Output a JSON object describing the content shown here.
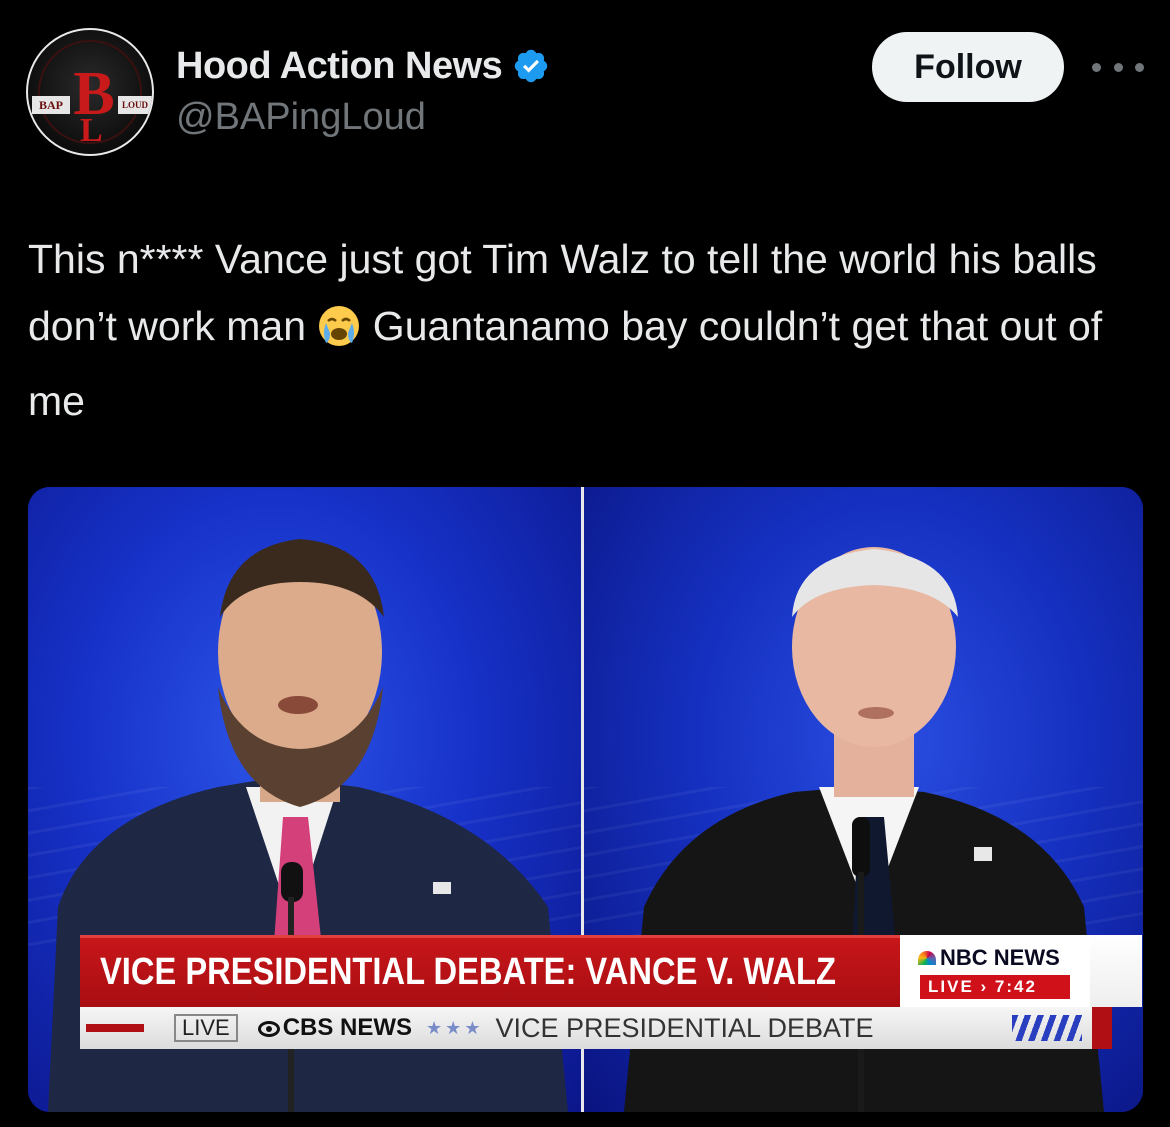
{
  "header": {
    "display_name": "Hood Action News",
    "handle": "@BAPingLoud",
    "follow_label": "Follow",
    "avatar": {
      "left_text": "BAP",
      "monogram_top": "B",
      "monogram_bottom": "L",
      "right_text": "LOUD"
    },
    "verified_icon": "verified-badge-icon",
    "more_icon": "more-options-icon"
  },
  "post": {
    "text_part1": "This n**** Vance just got Tim Walz to tell the world his balls don’t work man ",
    "emoji": "loudly-crying-face-emoji",
    "text_part2": " Guantanamo bay couldn’t get that out of me"
  },
  "media": {
    "chyron_title": "VICE PRESIDENTIAL DEBATE: VANCE V. WALZ",
    "nbc_logo_text": "NBC NEWS",
    "nbc_live_text": "LIVE › 7:42",
    "ticker_live": "LIVE",
    "ticker_network": "CBS NEWS",
    "ticker_dots": "★★★",
    "ticker_text": "VICE PRESIDENTIAL DEBATE"
  },
  "colors": {
    "background": "#000000",
    "text_primary": "#e7e9ea",
    "text_secondary": "#71767b",
    "verified_blue": "#1d9bf0",
    "follow_bg": "#eff3f4",
    "chyron_red": "#c7161a"
  }
}
